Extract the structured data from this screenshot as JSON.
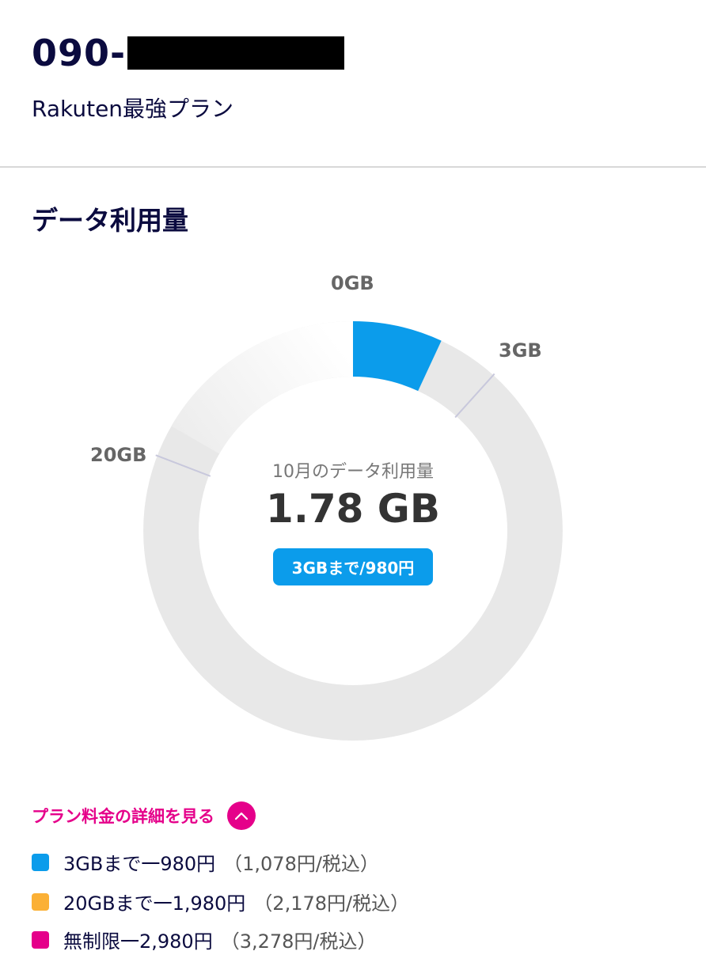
{
  "header": {
    "phone_prefix": "090-",
    "plan_name": "Rakuten最強プラン"
  },
  "usage": {
    "section_title": "データ利用量",
    "ring_labels": {
      "start": "0GB",
      "tier1": "3GB",
      "tier2": "20GB"
    },
    "caption": "10月のデータ利用量",
    "value": "1.78 GB",
    "used_gb": 1.78,
    "current_tier": "3GBまで/980円"
  },
  "details": {
    "link_label": "プラン料金の詳細を見る",
    "toggle_icon": "chevron-up-icon"
  },
  "legend": [
    {
      "main": "3GBまで一980円",
      "tax": "（1,078円/税込）",
      "color": "#0b9ceb"
    },
    {
      "main": "20GBまで一1,980円",
      "tax": "（2,178円/税込）",
      "color": "#fbb035"
    },
    {
      "main": "無制限一2,980円",
      "tax": " （3,278円/税込）",
      "color": "#e5008a"
    }
  ],
  "colors": {
    "accent_blue": "#0b9ceb",
    "accent_pink": "#e5008a",
    "navy_text": "#0b0b3f",
    "ring_track": "#e8e8e8"
  }
}
